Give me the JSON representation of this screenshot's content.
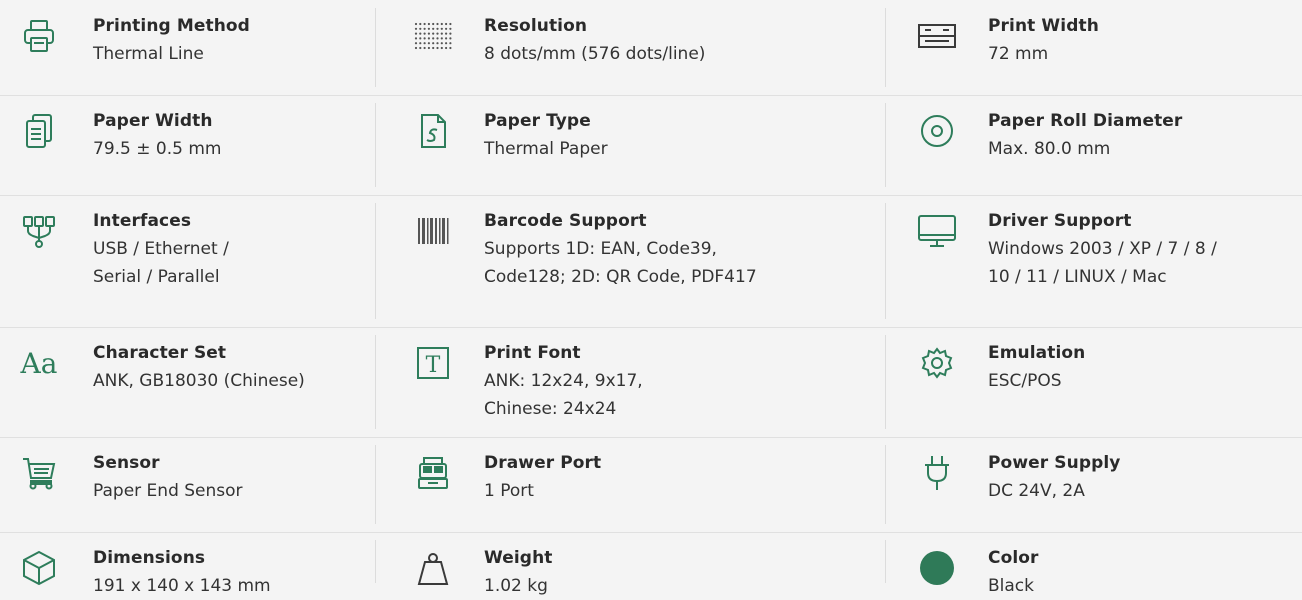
{
  "specs": [
    {
      "icon": "printer-icon",
      "label": "Printing Method",
      "value": "Thermal Line"
    },
    {
      "icon": "dot-matrix-icon",
      "label": "Resolution",
      "value": "8 dots/mm (576 dots/line)"
    },
    {
      "icon": "print-width-icon",
      "label": "Print Width",
      "value": "72 mm"
    },
    {
      "icon": "paper-sheets-icon",
      "label": "Paper Width",
      "value": "79.5 ± 0.5 mm"
    },
    {
      "icon": "paper-document-icon",
      "label": "Paper Type",
      "value": "Thermal Paper"
    },
    {
      "icon": "paper-roll-icon",
      "label": "Paper Roll Diameter",
      "value": "Max. 80.0 mm"
    },
    {
      "icon": "interfaces-icon",
      "label": "Interfaces",
      "value": "USB / Ethernet /\nSerial / Parallel"
    },
    {
      "icon": "barcode-icon",
      "label": "Barcode Support",
      "value": "Supports 1D: EAN, Code39,\nCode128; 2D: QR Code, PDF417"
    },
    {
      "icon": "monitor-icon",
      "label": "Driver Support",
      "value": "Windows 2003 / XP / 7 / 8 /\n10 / 11 / LINUX / Mac"
    },
    {
      "icon": "character-set-icon",
      "icon_text": "Aa",
      "label": "Character Set",
      "value": "ANK, GB18030 (Chinese)"
    },
    {
      "icon": "font-icon",
      "icon_text": "T",
      "label": "Print Font",
      "value": "ANK: 12x24, 9x17,\nChinese: 24x24"
    },
    {
      "icon": "gear-icon",
      "label": "Emulation",
      "value": "ESC/POS"
    },
    {
      "icon": "cart-icon",
      "label": "Sensor",
      "value": "Paper End Sensor"
    },
    {
      "icon": "cash-register-icon",
      "label": "Drawer Port",
      "value": "1 Port"
    },
    {
      "icon": "power-plug-icon",
      "label": "Power Supply",
      "value": "DC 24V, 2A"
    },
    {
      "icon": "box-icon",
      "label": "Dimensions",
      "value": "191 x 140 x 143 mm"
    },
    {
      "icon": "weight-icon",
      "label": "Weight",
      "value": "1.02 kg"
    },
    {
      "icon": "color-swatch-icon",
      "label": "Color",
      "value": "Black"
    }
  ],
  "colors": {
    "accent": "#2e7d5b",
    "icon_gray": "#3a3a3a",
    "background": "#f4f4f4",
    "swatch": "#2f7a58"
  }
}
